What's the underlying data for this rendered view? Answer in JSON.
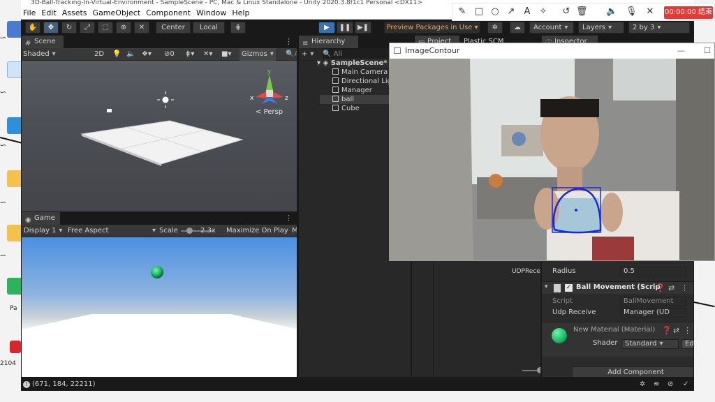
{
  "desktop": {
    "labels": [
      "ᯈ",
      "ᯈ",
      "ᯈ",
      "ᯈ",
      "ᯈ",
      "Pa",
      "2104"
    ]
  },
  "unity": {
    "title": "3D-Ball-Tracking-In-Virtual-Environment - SampleScene - PC, Mac & Linux Standalone - Unity 2020.3.8f1c1 Personal <DX11>",
    "menu": [
      "File",
      "Edit",
      "Assets",
      "GameObject",
      "Component",
      "Window",
      "Help"
    ],
    "toolbar": {
      "pivot_center": "Center",
      "pivot_local": "Local",
      "preview_packages": "Preview Packages in Use",
      "account": "Account",
      "layers": "Layers",
      "layout": "2 by 3"
    },
    "scene": {
      "tab": "Scene",
      "shading": "Shaded",
      "mode_2d": "2D",
      "gizmos": "Gizmos",
      "hidden_count": "0",
      "persp": "Persp",
      "search_hint": "A"
    },
    "game": {
      "tab": "Game",
      "display": "Display 1",
      "aspect": "Free Aspect",
      "scale_label": "Scale",
      "scale_value": "2.3x",
      "maximize": "Maximize On Play",
      "more": "M"
    },
    "hierarchy": {
      "tab": "Hierarchy",
      "search": "All",
      "scene": "SampleScene*",
      "items": [
        "Main Camera",
        "Directional Lig",
        "Manager",
        "ball",
        "Cube"
      ]
    },
    "project": {
      "tab": "Project",
      "asset": "UDPRecei..."
    },
    "plastic": {
      "tab": "Plastic SCM"
    },
    "inspector": {
      "tab": "Inspector",
      "radius_label": "Radius",
      "radius_value": "0.5",
      "component_name": "Ball Movement (Scrip",
      "script_label": "Script",
      "script_value": "BallMovement",
      "udp_label": "Udp Receive",
      "udp_value": "Manager (UD",
      "material_name": "New Material (Material)",
      "shader_label": "Shader",
      "shader_value": "Standard",
      "edit_button": "Edit...",
      "add_component": "Add Component"
    },
    "status": "(671, 184, 22211)"
  },
  "image_contour": {
    "title": "ImageContour"
  },
  "recorder": {
    "time": "00:00:00 结束"
  },
  "colors": {
    "unity_dark": "#191919",
    "panel": "#282828",
    "ball_green": "#1fbf6a",
    "contour_blue": "#1a2bd6",
    "record_red": "#e53935"
  }
}
